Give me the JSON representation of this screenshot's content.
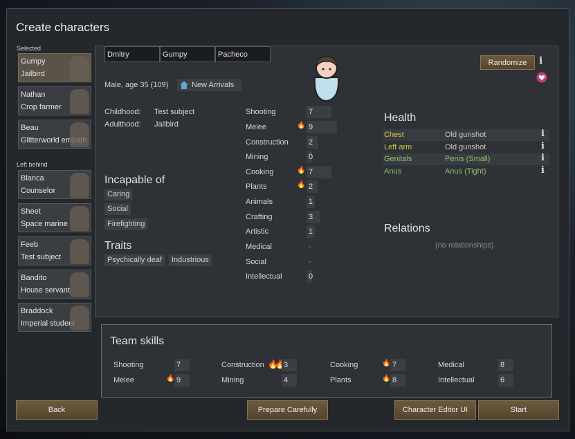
{
  "window_title": "Create characters",
  "sidebar": {
    "selected_label": "Selected",
    "left_behind_label": "Left behind",
    "selected": [
      {
        "name": "Gumpy",
        "title": "Jailbird"
      },
      {
        "name": "Nathan",
        "title": "Crop farmer"
      },
      {
        "name": "Beau",
        "title": "Glitterworld empath"
      }
    ],
    "left_behind": [
      {
        "name": "Blanca",
        "title": "Counselor"
      },
      {
        "name": "Sheet",
        "title": "Space marine"
      },
      {
        "name": "Feeb",
        "title": "Test subject"
      },
      {
        "name": "Bandito",
        "title": "House servant"
      },
      {
        "name": "Braddock",
        "title": "Imperial student"
      }
    ]
  },
  "pawn": {
    "first_name": "Dmitry",
    "nick_name": "Gumpy",
    "last_name": "Pacheco",
    "gender_age": "Male, age 35 (109)",
    "faction": "New Arrivals",
    "randomize_label": "Randomize",
    "childhood_label": "Childhood:",
    "childhood_value": "Test subject",
    "adulthood_label": "Adulthood:",
    "adulthood_value": "Jailbird",
    "incapable_heading": "Incapable of",
    "incapable": [
      "Caring",
      "Social",
      "Firefighting"
    ],
    "traits_heading": "Traits",
    "traits": [
      "Psychically deaf",
      "Industrious"
    ]
  },
  "skills": [
    {
      "name": "Shooting",
      "value": "7",
      "passion": "",
      "fill": 0.35
    },
    {
      "name": "Melee",
      "value": "9",
      "passion": "minor",
      "fill": 0.45
    },
    {
      "name": "Construction",
      "value": "2",
      "passion": "",
      "fill": 0.1
    },
    {
      "name": "Mining",
      "value": "0",
      "passion": "",
      "fill": 0.0
    },
    {
      "name": "Cooking",
      "value": "7",
      "passion": "minor",
      "fill": 0.35
    },
    {
      "name": "Plants",
      "value": "2",
      "passion": "minor",
      "fill": 0.1
    },
    {
      "name": "Animals",
      "value": "1",
      "passion": "",
      "fill": 0.05
    },
    {
      "name": "Crafting",
      "value": "3",
      "passion": "",
      "fill": 0.15
    },
    {
      "name": "Artistic",
      "value": "1",
      "passion": "",
      "fill": 0.05
    },
    {
      "name": "Medical",
      "value": "-",
      "passion": "",
      "fill": 0.0
    },
    {
      "name": "Social",
      "value": "-",
      "passion": "",
      "fill": 0.0
    },
    {
      "name": "Intellectual",
      "value": "0",
      "passion": "",
      "fill": 0.0
    }
  ],
  "health": {
    "heading": "Health",
    "rows": [
      {
        "part": "Chest",
        "condition": "Old gunshot",
        "part_color": "#d6c84a",
        "cond_color": "#c8c8c8"
      },
      {
        "part": "Left arm",
        "condition": "Old gunshot",
        "part_color": "#d6c84a",
        "cond_color": "#c8c8c8"
      },
      {
        "part": "Genitals",
        "condition": "Penis (Small)",
        "part_color": "#8fbf72",
        "cond_color": "#8fbf72"
      },
      {
        "part": "Anus",
        "condition": "Anus (Tight)",
        "part_color": "#8fbf72",
        "cond_color": "#8fbf72"
      }
    ]
  },
  "relations": {
    "heading": "Relations",
    "empty_text": "(no relationships)"
  },
  "team": {
    "heading": "Team skills",
    "skills": [
      {
        "name": "Shooting",
        "value": "7",
        "passion": ""
      },
      {
        "name": "Melee",
        "value": "9",
        "passion": "minor"
      },
      {
        "name": "Construction",
        "value": "3",
        "passion": "major"
      },
      {
        "name": "Mining",
        "value": "4",
        "passion": ""
      },
      {
        "name": "Cooking",
        "value": "7",
        "passion": "minor"
      },
      {
        "name": "Plants",
        "value": "8",
        "passion": "minor"
      },
      {
        "name": "Medical",
        "value": "8",
        "passion": ""
      },
      {
        "name": "Intellectual",
        "value": "6",
        "passion": ""
      }
    ]
  },
  "buttons": {
    "back": "Back",
    "prepare": "Prepare Carefully",
    "editor": "Character Editor UI",
    "start": "Start"
  },
  "colors": {
    "accent_button": "#6b5a3e",
    "passion": "#e8952b",
    "window_bg": "#24272b"
  },
  "icons": {
    "faction": "house-icon",
    "passion": "flame-icon",
    "info": "info-icon",
    "favorite": "heart-icon"
  }
}
